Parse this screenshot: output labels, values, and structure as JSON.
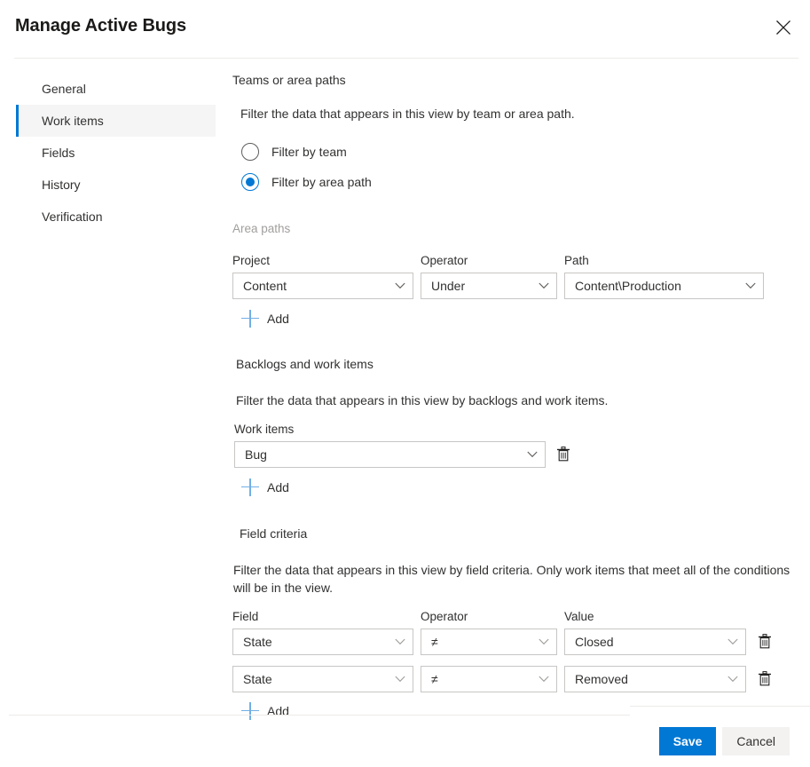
{
  "header": {
    "title": "Manage Active Bugs",
    "close_icon": "close-icon"
  },
  "sidebar": {
    "items": [
      {
        "label": "General",
        "selected": false
      },
      {
        "label": "Work items",
        "selected": true
      },
      {
        "label": "Fields",
        "selected": false
      },
      {
        "label": "History",
        "selected": false
      },
      {
        "label": "Verification",
        "selected": false
      }
    ]
  },
  "main": {
    "teams_section": {
      "title": "Teams or area paths",
      "description": "Filter the data that appears in this view by team or area path.",
      "radios": [
        {
          "label": "Filter by team",
          "checked": false
        },
        {
          "label": "Filter by area path",
          "checked": true
        }
      ]
    },
    "area_paths": {
      "group_label": "Area paths",
      "headers": {
        "project": "Project",
        "operator": "Operator",
        "path": "Path"
      },
      "rows": [
        {
          "project": "Content",
          "operator": "Under",
          "path": "Content\\Production"
        }
      ],
      "add_label": "Add",
      "add_icon": "plus-icon"
    },
    "backlogs_section": {
      "title": "Backlogs and work items",
      "description": "Filter the data that appears in this view by backlogs and work items.",
      "field_label": "Work items",
      "rows": [
        {
          "value": "Bug",
          "delete_icon": "trash-icon"
        }
      ],
      "add_label": "Add",
      "add_icon": "plus-icon"
    },
    "field_criteria": {
      "title": "Field criteria",
      "description": "Filter the data that appears in this view by field criteria. Only work items that meet all of the conditions will be in the view.",
      "headers": {
        "field": "Field",
        "operator": "Operator",
        "value": "Value"
      },
      "rows": [
        {
          "field": "State",
          "operator": "≠",
          "value": "Closed",
          "delete_icon": "trash-icon"
        },
        {
          "field": "State",
          "operator": "≠",
          "value": "Removed",
          "delete_icon": "trash-icon"
        }
      ],
      "add_label": "Add",
      "add_icon": "plus-icon"
    }
  },
  "footer": {
    "save_label": "Save",
    "cancel_label": "Cancel"
  },
  "colors": {
    "accent": "#0078d4",
    "selected_bg": "#f5f5f5",
    "border": "#c8c6c4",
    "divider": "#edebe9",
    "add_plus": "#71afe5",
    "muted_text": "#a19f9d",
    "cancel_bg": "#f3f2f1"
  }
}
